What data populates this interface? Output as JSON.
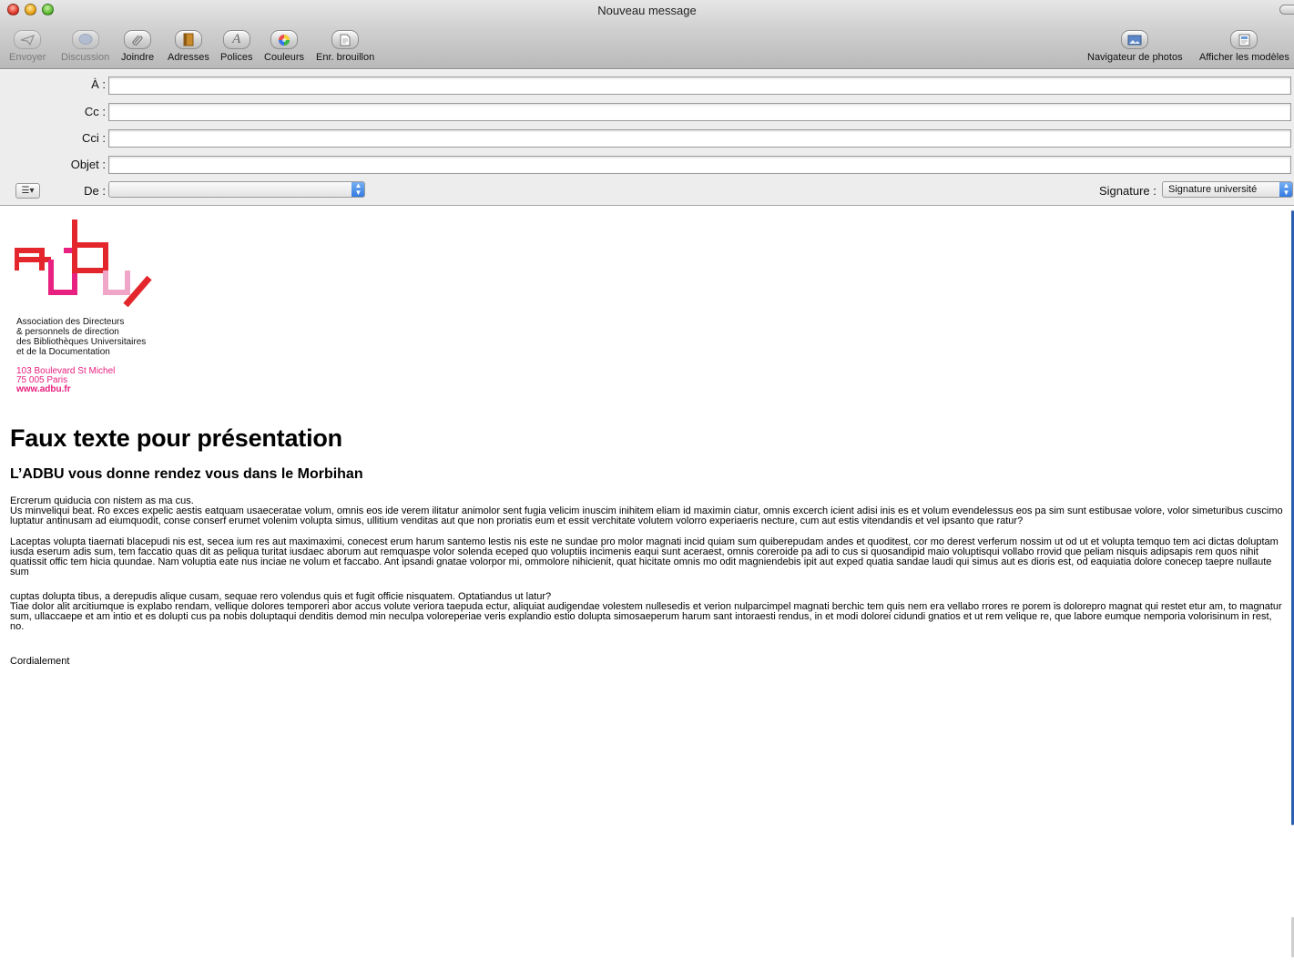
{
  "window": {
    "title": "Nouveau message"
  },
  "toolbar": {
    "send": "Envoyer",
    "chat": "Discussion",
    "attach": "Joindre",
    "addresses": "Adresses",
    "fonts": "Polices",
    "colors": "Couleurs",
    "save_draft": "Enr. brouillon",
    "photo_browser": "Navigateur de photos",
    "show_templates": "Afficher les modèles"
  },
  "header": {
    "to_label": "À :",
    "cc_label": "Cc :",
    "bcc_label": "Cci :",
    "subject_label": "Objet :",
    "from_label": "De :",
    "from_value": "",
    "signature_label": "Signature :",
    "signature_value": "Signature université"
  },
  "body": {
    "org_lines": [
      "Association des Directeurs",
      "& personnels de direction",
      "des Bibliothèques Universitaires",
      "et de la Documentation"
    ],
    "address_lines": [
      "103 Boulevard St Michel",
      "75 005 Paris"
    ],
    "website": "www.adbu.fr",
    "title": "Faux texte pour présentation",
    "subtitle": "L’ADBU vous donne rendez vous dans le Morbihan",
    "p1_line1": "Ercrerum quiducia con nistem as ma cus.",
    "p1_rest": "Us minveliqui beat. Ro exces expelic aestis eatquam usaeceratae volum, omnis eos ide verem ilitatur animolor sent fugia velicim inuscim inihitem eliam id maximin ciatur, omnis excerch icient adisi inis es et volum evendelessus eos pa sim sunt estibusae volore, volor simeturibus cuscimo luptatur antinusam ad eiumquodit, conse conserf erumet volenim volupta simus, ullitium venditas aut que non proriatis eum et essit verchitate volutem volorro experiaeris necture, cum aut estis vitendandis et vel ipsanto que ratur?",
    "p2": "Laceptas volupta tiaernati blacepudi nis est, secea ium res aut maximaximi, conecest erum harum santemo lestis nis este ne sundae pro molor magnati incid quiam sum quiberepudam andes et quoditest, cor mo derest verferum nossim ut od ut et volupta temquo tem aci dictas doluptam iusda eserum adis sum, tem faccatio quas dit as peliqua turitat iusdaec aborum aut remquaspe volor solenda eceped quo voluptiis incimenis eaqui sunt aceraest, omnis coreroide pa adi to cus si quosandipid maio voluptisqui vollabo rrovid que peliam nisquis adipsapis rem quos nihit quatissit offic tem hicia quundae. Nam voluptia eate nus inciae ne volum et faccabo. Ant ipsandi gnatae volorpor mi, ommolore nihicienit, quat hicitate omnis mo odit magniendebis ipit aut exped quatia sandae laudi qui simus aut es dioris est, od eaquiatia dolore conecep taepre nullaute sum",
    "p3_line1": "cuptas dolupta tibus, a derepudis alique cusam, sequae rero volendus quis et fugit officie nisquatem. Optatiandus ut latur?",
    "p3_rest": "Tiae dolor alit arcitiumque is explabo rendam, vellique dolores temporeri abor accus volute veriora taepuda ectur, aliquiat audigendae volestem nullesedis et verion nulparcimpel magnati berchic tem quis nem era vellabo rrores re porem is dolorepro magnat qui restet etur am, to magnatur sum, ullaccaepe et am intio et es dolupti cus pa nobis doluptaqui denditis demod min neculpa voloreperiae veris explandio estio dolupta simosaeperum harum sant intoraesti rendus, in et modi dolorei cidundi gnatios et ut rem velique re, que labore eumque nemporia volorisinum in rest, no.",
    "closing": "Cordialement"
  },
  "colors": {
    "logo_red": "#e3262b",
    "logo_magenta": "#e8207f",
    "logo_pink": "#f0a6c9",
    "select_blue": "#2f77de"
  },
  "icons": {
    "send": "paper-plane-icon",
    "chat": "speech-bubble-icon",
    "attach": "paperclip-icon",
    "addresses": "address-book-icon",
    "fonts": "font-icon",
    "colors": "color-wheel-icon",
    "save_draft": "draft-document-icon",
    "photo_browser": "photo-icon",
    "show_templates": "templates-icon"
  }
}
